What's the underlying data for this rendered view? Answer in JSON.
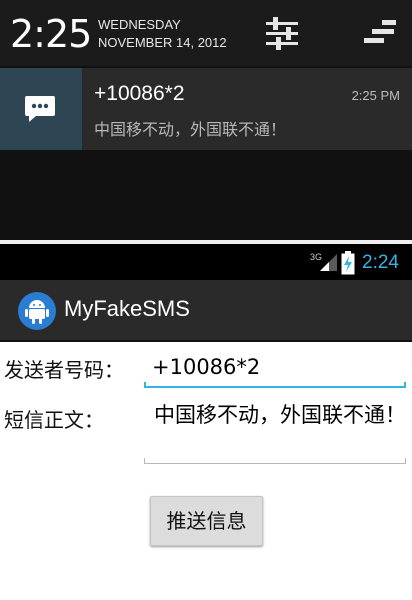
{
  "notification_shade": {
    "clock": "2:25",
    "weekday": "WEDNESDAY",
    "date": "NOVEMBER 14, 2012",
    "settings_icon": "sliders-icon",
    "clear_icon": "clear-all-icon",
    "notification": {
      "icon": "sms-message-icon",
      "title": "+10086*2",
      "time": "2:25 PM",
      "text": "中国移不动，外国联不通！"
    }
  },
  "status_bar": {
    "network": "3G",
    "time": "2:24",
    "time_color": "#33b5e5"
  },
  "action_bar": {
    "app_icon": "android-icon",
    "title": "MyFakeSMS"
  },
  "form": {
    "sender_label": "发送者号码：",
    "sender_value": "+10086*2",
    "body_label": "短信正文：",
    "body_value": "中国移不动，外国联不通！",
    "send_button": "推送信息",
    "accent_color": "#33b5e5"
  }
}
